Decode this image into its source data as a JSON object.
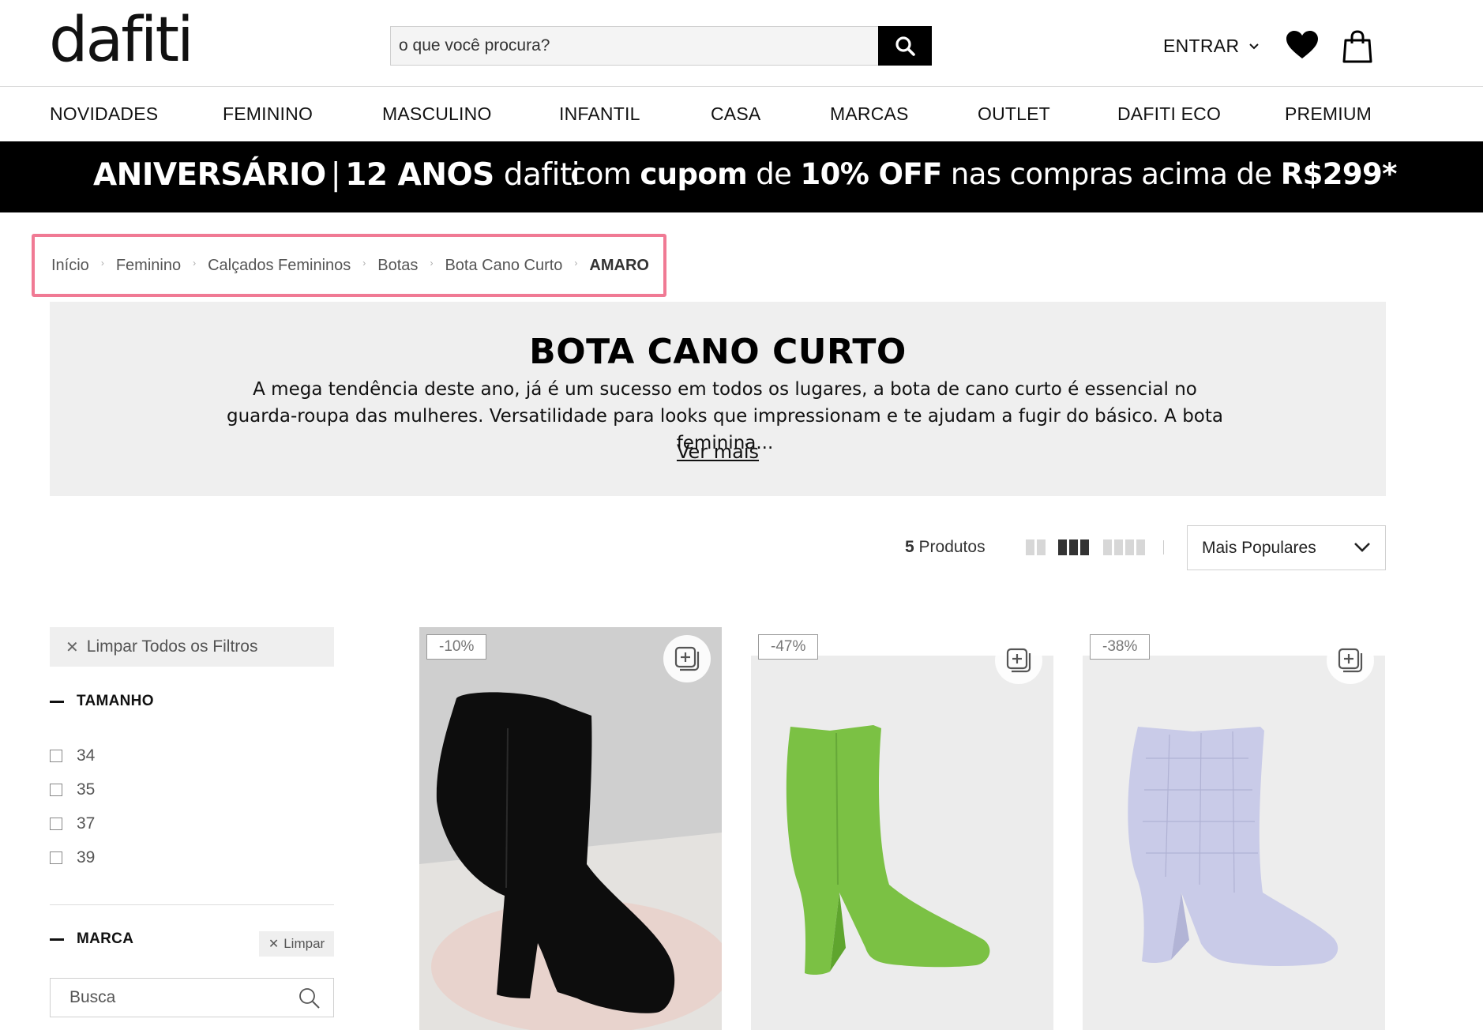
{
  "header": {
    "logo": "dafiti",
    "search_placeholder": "o que você procura?",
    "login_label": "ENTRAR"
  },
  "nav": [
    {
      "label": "NOVIDADES"
    },
    {
      "label": "FEMININO"
    },
    {
      "label": "MASCULINO"
    },
    {
      "label": "INFANTIL"
    },
    {
      "label": "CASA"
    },
    {
      "label": "MARCAS"
    },
    {
      "label": "OUTLET"
    },
    {
      "label": "DAFITI ECO"
    },
    {
      "label": "PREMIUM"
    }
  ],
  "promo": {
    "left_main": "ANIVERSÁRIO",
    "left_sep": "|",
    "left_years": "12 ANOS",
    "left_brand": "dafiti",
    "right_pre": "com ",
    "right_b1": "cupom",
    "right_mid": " de ",
    "right_b2": "10% OFF",
    "right_post": " nas compras acima de ",
    "right_b3": "R$299*"
  },
  "breadcrumb": [
    {
      "label": "Início"
    },
    {
      "label": "Feminino"
    },
    {
      "label": "Calçados Femininos"
    },
    {
      "label": "Botas"
    },
    {
      "label": "Bota Cano Curto"
    },
    {
      "label": "AMARO"
    }
  ],
  "hero": {
    "title": "BOTA CANO CURTO",
    "description": "A mega tendência deste ano, já é um sucesso em todos os lugares, a bota de cano curto é essencial no guarda-roupa das mulheres. Versatilidade para looks que impressionam e te ajudam a fugir do básico. A bota feminina...",
    "more_label": "Ver mais"
  },
  "toolbar": {
    "count_number": "5",
    "count_label": " Produtos",
    "sort_selected": "Mais Populares"
  },
  "filters": {
    "clear_all": "Limpar Todos os Filtros",
    "size_title": "TAMANHO",
    "sizes": [
      "34",
      "35",
      "37",
      "39"
    ],
    "brand_title": "MARCA",
    "brand_clear": "Limpar",
    "brand_search_placeholder": "Busca"
  },
  "products": [
    {
      "discount": "-10%",
      "color": "#111111"
    },
    {
      "discount": "-47%",
      "color": "#7bc144"
    },
    {
      "discount": "-38%",
      "color": "#c9cbe8"
    }
  ],
  "icons": {
    "search": "search-icon",
    "chevron": "chevron-down-icon",
    "heart": "heart-icon",
    "bag": "shopping-bag-icon",
    "wishlist_add": "add-to-list-icon"
  }
}
